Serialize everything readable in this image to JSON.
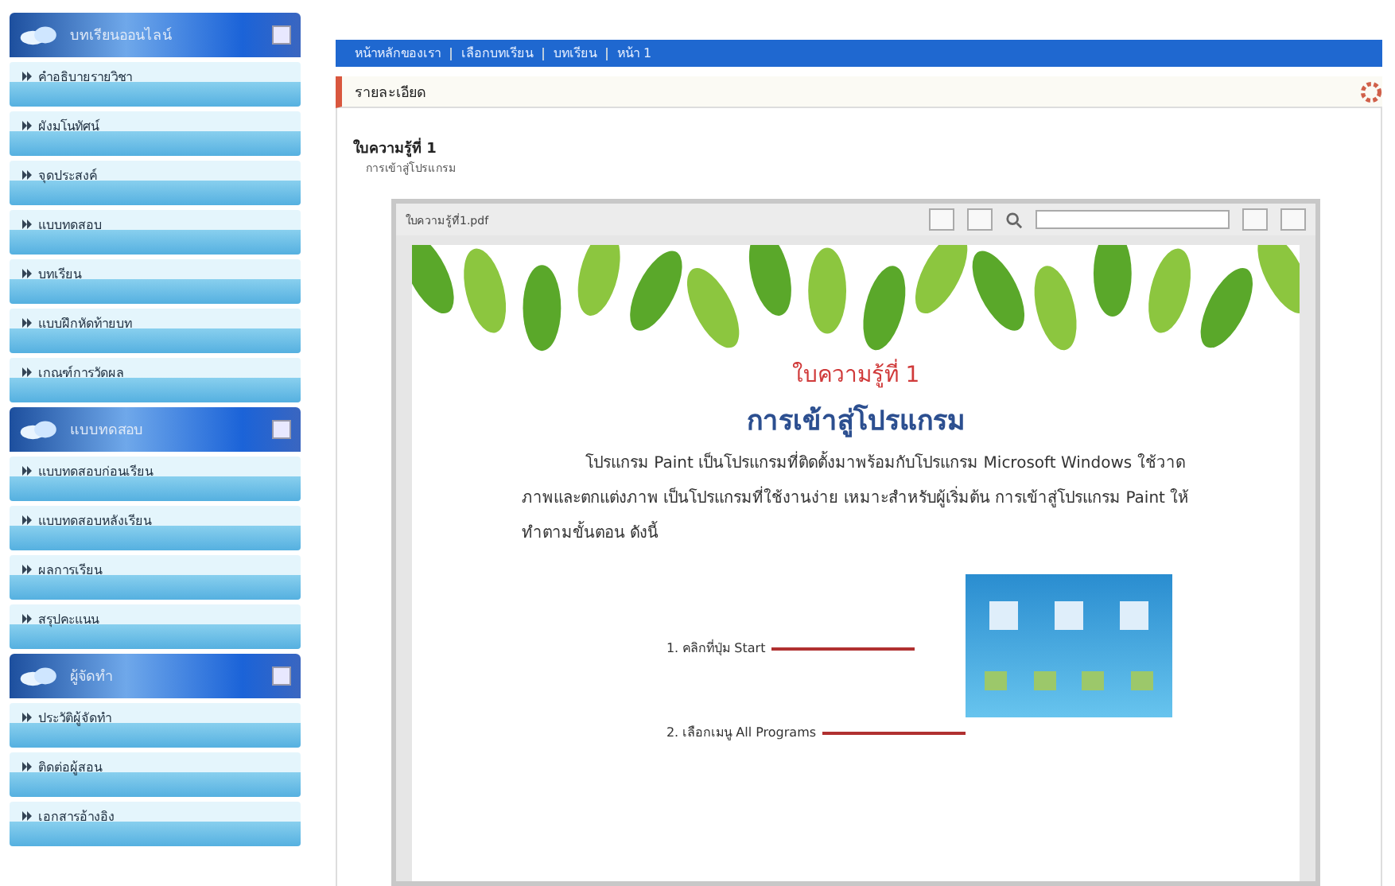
{
  "sidebar": {
    "sections": [
      {
        "title": "บทเรียนออนไลน์",
        "items": [
          "คำอธิบายรายวิชา",
          "ผังมโนทัศน์",
          "จุดประสงค์",
          "แบบทดสอบ",
          "บทเรียน",
          "แบบฝึกหัดท้ายบท",
          "เกณฑ์การวัดผล"
        ]
      },
      {
        "title": "แบบทดสอบ",
        "items": [
          "แบบทดสอบก่อนเรียน",
          "แบบทดสอบหลังเรียน",
          "ผลการเรียน",
          "สรุปคะแนน"
        ]
      },
      {
        "title": "ผู้จัดทำ",
        "items": [
          "ประวัติผู้จัดทำ",
          "ติดต่อผู้สอน",
          "เอกสารอ้างอิง"
        ]
      }
    ]
  },
  "breadcrumb": [
    "หน้าหลักของเรา",
    "เลือกบทเรียน",
    "บทเรียน",
    "หน้า 1"
  ],
  "panel": {
    "title": "รายละเอียด"
  },
  "content": {
    "title": "ใบความรู้ที่ 1",
    "subtitle": "การเข้าสู่โปรแกรม"
  },
  "viewer": {
    "file_name": "ใบความรู้ที่1.pdf",
    "page": {
      "heading": "ใบความรู้ที่ 1",
      "title": "การเข้าสู่โปรแกรม",
      "paragraph": "โปรแกรม Paint เป็นโปรแกรมที่ติดตั้งมาพร้อมกับโปรแกรม Microsoft Windows ใช้วาดภาพและตกแต่งภาพ เป็นโปรแกรมที่ใช้งานง่าย เหมาะสำหรับผู้เริ่มต้น การเข้าสู่โปรแกรม Paint ให้ทำตามขั้นตอน ดังนี้",
      "steps": [
        "1. คลิกที่ปุ่ม Start",
        "2. เลือกเมนู All Programs"
      ]
    }
  }
}
